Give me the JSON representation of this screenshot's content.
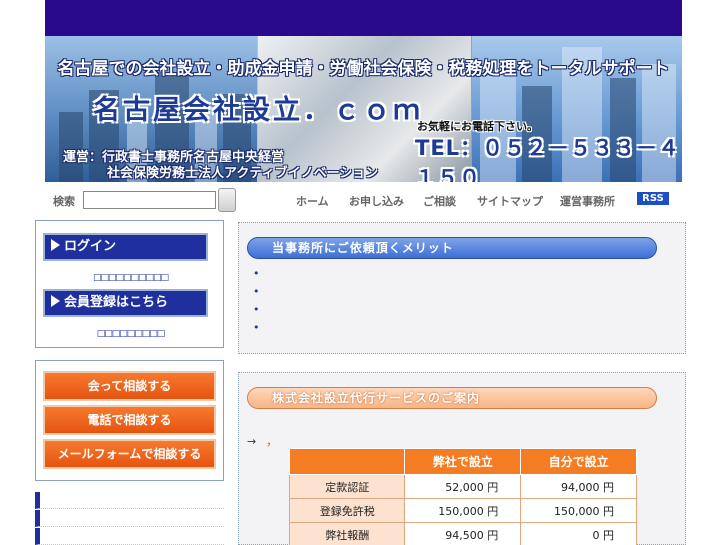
{
  "banner": {
    "tagline": "名古屋での会社設立・助成金申請・労働社会保険・税務処理をトータルサポート",
    "title": "名古屋会社設立．ｃｏｍ",
    "call_text": "お気軽にお電話下さい。",
    "tel": "TEL：０５２－５３３－４１５０",
    "operator_line1": "運営：行政書士事務所名古屋中央経営",
    "operator_line2": "社会保険労務士法人アクティブイノベーション"
  },
  "nav": {
    "search_label": "検索",
    "search_value": "",
    "links": [
      "ホーム",
      "お申し込み",
      "ご相談",
      "サイトマップ",
      "運営事務所"
    ],
    "rss": "RSS"
  },
  "sidebar": {
    "login_label": "ログイン",
    "login_sub": "□□□□□□□□□□",
    "register_label": "会員登録はこちら",
    "register_sub": "□□□□□□□□□",
    "consult_buttons": [
      "会って相談する",
      "電話で相談する",
      "メールフォームで相談する"
    ]
  },
  "merit": {
    "heading": "当事務所にご依頼頂くメリット",
    "items": [
      "",
      "",
      "",
      ""
    ]
  },
  "service": {
    "heading": "株式会社設立代行サービスのご案内",
    "arrow_text": "→",
    "comma": "，",
    "table": {
      "headers": [
        "",
        "弊社で設立",
        "自分で設立"
      ],
      "rows": [
        [
          "定款認証",
          "52,000 円",
          "94,000 円"
        ],
        [
          "登録免許税",
          "150,000 円",
          "150,000 円"
        ],
        [
          "弊社報酬",
          "94,500 円",
          "0 円"
        ]
      ]
    }
  },
  "colors": {
    "navy": "#2a0a8c",
    "blue_button": "#1f2f9e",
    "orange_button": "#e55410",
    "table_header": "#f47c22"
  }
}
